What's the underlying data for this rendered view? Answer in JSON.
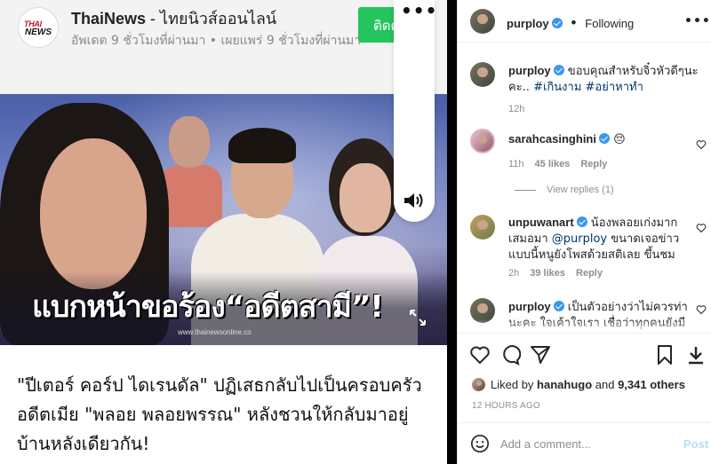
{
  "news": {
    "logo": {
      "top": "THAI",
      "bottom": "NEWS"
    },
    "source_name": "ThaiNews",
    "source_subtitle": " - ไทยนิวส์ออนไลน์",
    "meta": "อัพเดต 9 ชั่วโมงที่ผ่านมา • เผยแพร่ 9 ชั่วโมงที่ผ่านมา",
    "follow_label": "ติดตาม",
    "image_caption": "แบกหน้าขอร้อง“อดีตสามี”!",
    "image_watermark": "www.thainewsonline.co",
    "body": "\"ปีเตอร์ คอร์ป ไดเรนดัล\" ปฏิเสธกลับไปเป็นครอบครัวอดีตเมีย \"พลอย พลอยพรรณ\" หลังชวนให้กลับมาอยู่บ้านหลังเดียวกัน!"
  },
  "instagram": {
    "header": {
      "username": "purploy",
      "separator": "•",
      "follow_state": "Following"
    },
    "caption": {
      "username": "purploy",
      "text": " ขอบคุณสำหรับจิ๋วหัวดีๆนะคะ.. ",
      "tags": "#เกินงาม #อย่าหาทำ",
      "time": "12h"
    },
    "comments": [
      {
        "username": "sarahcasinghini",
        "text": " 😔",
        "time": "11h",
        "likes": "45 likes",
        "reply": "Reply"
      },
      {
        "username": "unpuwanart",
        "text": " น้องพลอยเก่งมากเสมอมา ",
        "mention": "@purploy",
        "text2": " ขนาดเจอข่าวแบบนี้หนูยังโพสด้วยสติเลย ขึ้นชม",
        "time": "2h",
        "likes": "39 likes",
        "reply": "Reply"
      },
      {
        "username": "purploy",
        "text": " เป็นตัวอย่างว่าไม่ควรท่านะคะ ใจเค้าใจเรา เชื่อว่าทุกคนยังมีความ"
      }
    ],
    "view_replies": "View replies (1)",
    "liked_by_prefix": "Liked by ",
    "liked_by_user": "hanahugo",
    "liked_by_and": " and ",
    "liked_by_count": "9,341 others",
    "time_ago": "12 HOURS AGO",
    "add_comment_placeholder": "Add a comment...",
    "post_label": "Post",
    "colors": {
      "link": "#00376b",
      "verified": "#3897f0",
      "post_disabled": "#b2dffc",
      "follow_green": "#24c45e"
    }
  }
}
